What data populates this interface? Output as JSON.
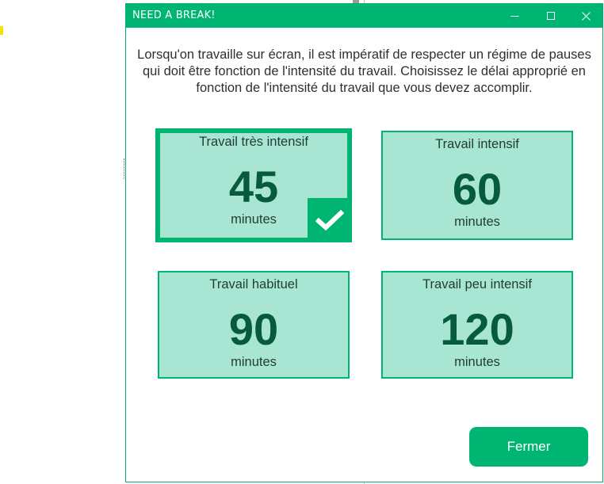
{
  "window": {
    "title": "NEED A BREAK!",
    "accent_color": "#00b571",
    "card_color": "#a8e5d3",
    "value_color": "#065a3e"
  },
  "titlebar_controls": {
    "minimize_icon": "minimize-icon",
    "maximize_icon": "maximize-icon",
    "close_icon": "close-icon"
  },
  "intro_text": "Lorsqu'on travaille sur écran, il est impératif de respecter un régime de pauses qui doit être fonction de l'intensité du travail. Choisissez le délai approprié en fonction de l'intensité du travail que vous devez accomplir.",
  "options": [
    {
      "label": "Travail très intensif",
      "value": "45",
      "unit": "minutes",
      "selected": true
    },
    {
      "label": "Travail intensif",
      "value": "60",
      "unit": "minutes",
      "selected": false
    },
    {
      "label": "Travail habituel",
      "value": "90",
      "unit": "minutes",
      "selected": false
    },
    {
      "label": "Travail peu intensif",
      "value": "120",
      "unit": "minutes",
      "selected": false
    }
  ],
  "selected_icon": "checkmark-icon",
  "close_button_label": "Fermer"
}
